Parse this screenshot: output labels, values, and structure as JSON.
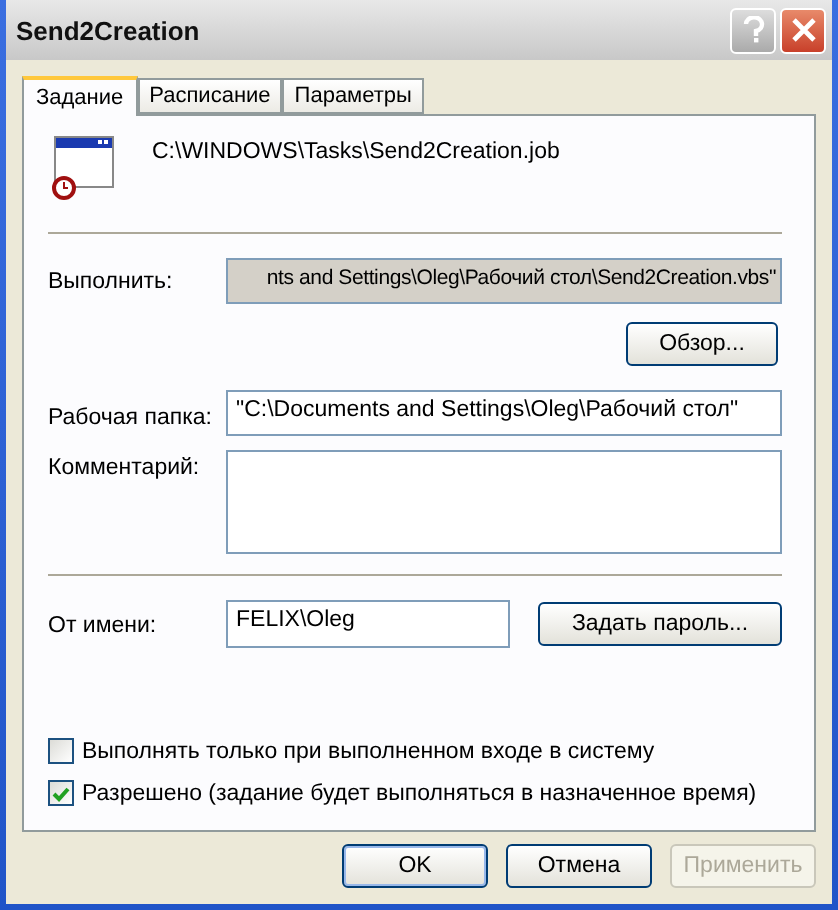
{
  "window": {
    "title": "Send2Creation"
  },
  "tabs": [
    {
      "label": "Задание",
      "selected": true
    },
    {
      "label": "Расписание",
      "selected": false
    },
    {
      "label": "Параметры",
      "selected": false
    }
  ],
  "task_path": "C:\\WINDOWS\\Tasks\\Send2Creation.job",
  "run": {
    "label": "Выполнить:",
    "value": "nts and Settings\\Oleg\\Рабочий стол\\Send2Creation.vbs\"",
    "selected": true
  },
  "browse_button": "Обзор...",
  "start_in": {
    "label": "Рабочая папка:",
    "value": "\"C:\\Documents and Settings\\Oleg\\Рабочий стол\""
  },
  "comments": {
    "label": "Комментарий:"
  },
  "run_as": {
    "label": "От имени:",
    "value": "FELIX\\Oleg"
  },
  "set_password_button": "Задать пароль...",
  "checkboxes": [
    {
      "label": "Выполнять только при выполненном входе в систему",
      "checked": false
    },
    {
      "label": "Разрешено (задание будет выполняться в назначенное время)",
      "checked": true
    }
  ],
  "buttons": [
    {
      "label": "OK",
      "disabled": false,
      "default": true
    },
    {
      "label": "Отмена",
      "disabled": false,
      "default": false
    },
    {
      "label": "Применить",
      "disabled": true,
      "default": false
    }
  ]
}
